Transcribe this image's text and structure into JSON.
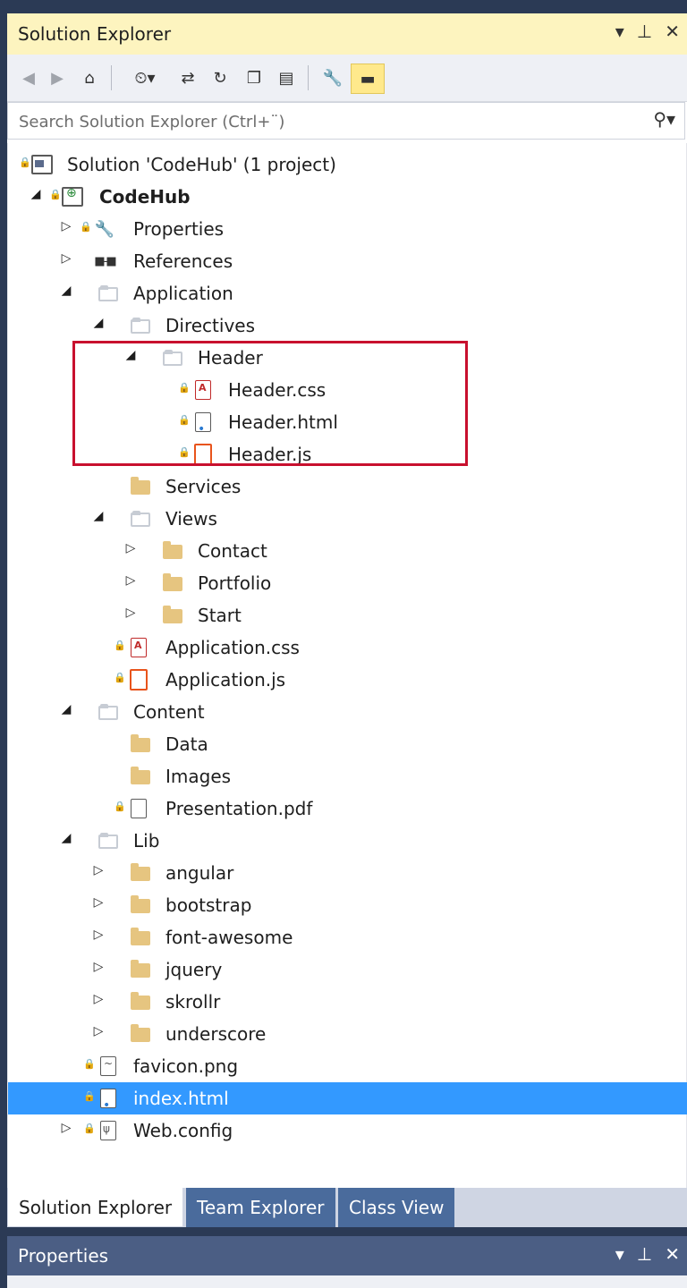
{
  "panel": {
    "title": "Solution Explorer",
    "controls": [
      "▾",
      "⊥",
      "✕"
    ]
  },
  "toolbar": {
    "buttons": [
      "back-icon",
      "forward-icon",
      "home-icon",
      "pending-changes-icon",
      "sync-icon",
      "refresh-icon",
      "collapse-all-icon",
      "show-all-files-icon",
      "properties-icon",
      "preview-icon"
    ]
  },
  "search": {
    "placeholder": "Search Solution Explorer (Ctrl+¨)",
    "icon": "search-icon"
  },
  "tree": {
    "items": [
      {
        "label": "Solution 'CodeHub' (1 project)",
        "icon": "solution-icon"
      },
      {
        "label": "CodeHub",
        "icon": "project-icon"
      },
      {
        "label": "Properties",
        "icon": "wrench-icon"
      },
      {
        "label": "References",
        "icon": "references-icon"
      },
      {
        "label": "Application",
        "icon": "folder-open-icon"
      },
      {
        "label": "Directives",
        "icon": "folder-open-icon"
      },
      {
        "label": "Header",
        "icon": "folder-open-icon"
      },
      {
        "label": "Header.css",
        "icon": "css-file-icon"
      },
      {
        "label": "Header.html",
        "icon": "html-file-icon"
      },
      {
        "label": "Header.js",
        "icon": "js-file-icon"
      },
      {
        "label": "Services",
        "icon": "folder-icon"
      },
      {
        "label": "Views",
        "icon": "folder-open-icon"
      },
      {
        "label": "Contact",
        "icon": "folder-icon"
      },
      {
        "label": "Portfolio",
        "icon": "folder-icon"
      },
      {
        "label": "Start",
        "icon": "folder-icon"
      },
      {
        "label": "Application.css",
        "icon": "css-file-icon"
      },
      {
        "label": "Application.js",
        "icon": "js-file-icon"
      },
      {
        "label": "Content",
        "icon": "folder-open-icon"
      },
      {
        "label": "Data",
        "icon": "folder-icon"
      },
      {
        "label": "Images",
        "icon": "folder-icon"
      },
      {
        "label": "Presentation.pdf",
        "icon": "file-icon"
      },
      {
        "label": "Lib",
        "icon": "folder-open-icon"
      },
      {
        "label": "angular",
        "icon": "folder-icon"
      },
      {
        "label": "bootstrap",
        "icon": "folder-icon"
      },
      {
        "label": "font-awesome",
        "icon": "folder-icon"
      },
      {
        "label": "jquery",
        "icon": "folder-icon"
      },
      {
        "label": "skrollr",
        "icon": "folder-icon"
      },
      {
        "label": "underscore",
        "icon": "folder-icon"
      },
      {
        "label": "favicon.png",
        "icon": "image-file-icon"
      },
      {
        "label": "index.html",
        "icon": "html-file-icon",
        "selected": true
      },
      {
        "label": "Web.config",
        "icon": "config-file-icon"
      }
    ]
  },
  "tabs": [
    {
      "label": "Solution Explorer",
      "active": true
    },
    {
      "label": "Team Explorer",
      "active": false
    },
    {
      "label": "Class View",
      "active": false
    }
  ],
  "properties": {
    "title": "Properties",
    "controls": [
      "▾",
      "⊥",
      "✕"
    ]
  },
  "colors": {
    "titlebar": "#fdf4bf",
    "selection": "#3399ff",
    "highlight_box": "#c8102e",
    "tab_inactive": "#4a6b9c"
  }
}
